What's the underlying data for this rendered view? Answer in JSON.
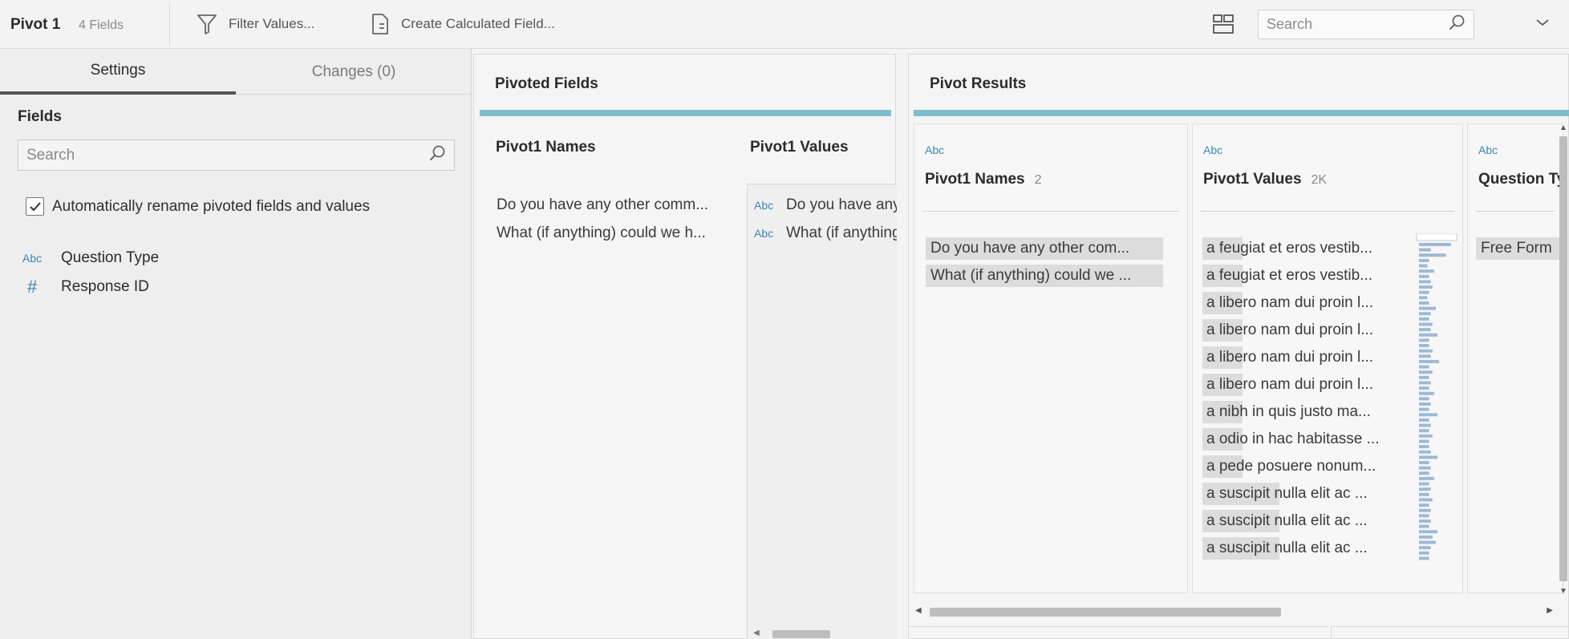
{
  "toolbar": {
    "title": "Pivot 1",
    "field_count": "4 Fields",
    "filter_label": "Filter Values...",
    "calc_label": "Create Calculated Field...",
    "search_placeholder": "Search"
  },
  "left": {
    "tabs": [
      {
        "label": "Settings",
        "active": true
      },
      {
        "label": "Changes (0)",
        "active": false
      }
    ],
    "fields_title": "Fields",
    "search_placeholder": "Search",
    "auto_rename_label": "Automatically rename pivoted fields and values",
    "auto_rename_checked": true,
    "fields": [
      {
        "type": "Abc",
        "type_icon": "string-type-icon",
        "name": "Question Type"
      },
      {
        "type": "#",
        "type_icon": "number-type-icon",
        "name": "Response ID"
      }
    ]
  },
  "pivoted": {
    "title": "Pivoted Fields",
    "names_header": "Pivot1 Names",
    "values_header": "Pivot1 Values",
    "names": [
      "Do you have any other comm...",
      "What (if anything) could we h..."
    ],
    "values": [
      {
        "type": "Abc",
        "text": "Do you have any other comments?"
      },
      {
        "type": "Abc",
        "text": "What (if anything) could we have done better?"
      }
    ]
  },
  "results": {
    "title": "Pivot Results",
    "accent_color": "#7fbecb",
    "highlight_color": "#dcdcdc",
    "type_color": "#3a86b4",
    "cards": [
      {
        "type": "Abc",
        "name": "Pivot1 Names",
        "count": "2",
        "values": [
          "Do you have any other com...",
          "What (if anything) could we ..."
        ]
      },
      {
        "type": "Abc",
        "name": "Pivot1 Values",
        "count": "2K",
        "values": [
          {
            "text": "a feugiat et eros vestib...",
            "highlight": 0.21
          },
          {
            "text": "a feugiat et eros vestib...",
            "highlight": 0.21
          },
          {
            "text": "a libero nam dui proin l...",
            "highlight": 0.21
          },
          {
            "text": "a libero nam dui proin l...",
            "highlight": 0.21
          },
          {
            "text": "a libero nam dui proin l...",
            "highlight": 0.21
          },
          {
            "text": "a libero nam dui proin l...",
            "highlight": 0.21
          },
          {
            "text": "a nibh in quis justo ma...",
            "highlight": 0.21
          },
          {
            "text": "a odio in hac habitasse ...",
            "highlight": 0.21
          },
          {
            "text": "a pede posuere nonum...",
            "highlight": 0.21
          },
          {
            "text": "a suscipit nulla elit ac ...",
            "highlight": 0.4
          },
          {
            "text": "a suscipit nulla elit ac ...",
            "highlight": 0.4
          },
          {
            "text": "a suscipit nulla elit ac ...",
            "highlight": 0.4
          }
        ],
        "histogram": [
          0.95,
          0.35,
          0.8,
          0.3,
          0.25,
          0.45,
          0.3,
          0.35,
          0.4,
          0.3,
          0.25,
          0.3,
          0.5,
          0.35,
          0.3,
          0.4,
          0.35,
          0.55,
          0.3,
          0.3,
          0.4,
          0.35,
          0.6,
          0.3,
          0.4,
          0.3,
          0.35,
          0.3,
          0.45,
          0.3,
          0.35,
          0.3,
          0.55,
          0.3,
          0.35,
          0.3,
          0.4,
          0.3,
          0.3,
          0.35,
          0.55,
          0.3,
          0.35,
          0.3,
          0.45,
          0.3,
          0.35,
          0.3,
          0.4,
          0.3,
          0.35,
          0.3,
          0.35,
          0.3,
          0.55,
          0.4,
          0.5,
          0.35,
          0.3,
          0.3
        ]
      },
      {
        "type": "Abc",
        "name": "Question Type",
        "count": "",
        "values": [
          "Free Form"
        ]
      }
    ]
  }
}
